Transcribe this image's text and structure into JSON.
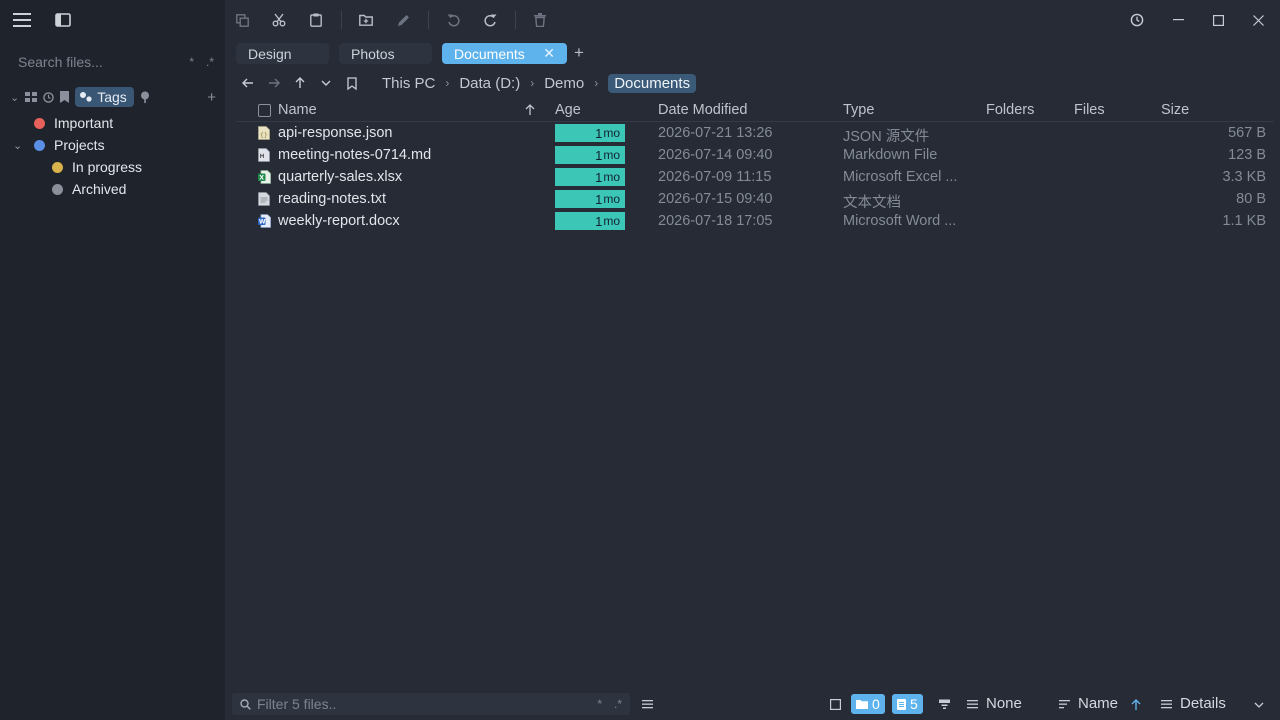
{
  "sidebar": {
    "search_placeholder": "Search files...",
    "search_mod_star": "*",
    "search_mod_regex": ".*",
    "tags_label": "Tags",
    "tree": [
      {
        "label": "Important",
        "color": "#e8605a"
      },
      {
        "label": "Projects",
        "color": "#5b8ee6"
      },
      {
        "label": "In progress",
        "color": "#d8b24a"
      },
      {
        "label": "Archived",
        "color": "#8b8f99"
      }
    ]
  },
  "tabs": [
    {
      "label": "Design"
    },
    {
      "label": "Photos"
    },
    {
      "label": "Documents"
    }
  ],
  "tab_close": "✕",
  "tab_new": "+",
  "breadcrumb": [
    "This PC",
    "Data (D:)",
    "Demo",
    "Documents"
  ],
  "breadcrumb_sep": "›",
  "columns": {
    "name": "Name",
    "age": "Age",
    "date_modified": "Date Modified",
    "type": "Type",
    "folders": "Folders",
    "files": "Files",
    "size": "Size"
  },
  "files": [
    {
      "name": "api-response.json",
      "age_num": "1",
      "age_unit": "mo",
      "date": "2026-07-21 13:26",
      "type": "JSON 源文件",
      "size": "567 B",
      "icon": "json-file-icon"
    },
    {
      "name": "meeting-notes-0714.md",
      "age_num": "1",
      "age_unit": "mo",
      "date": "2026-07-14 09:40",
      "type": "Markdown File",
      "size": "123 B",
      "icon": "markdown-file-icon"
    },
    {
      "name": "quarterly-sales.xlsx",
      "age_num": "1",
      "age_unit": "mo",
      "date": "2026-07-09 11:15",
      "type": "Microsoft Excel ...",
      "size": "3.3 KB",
      "icon": "excel-file-icon"
    },
    {
      "name": "reading-notes.txt",
      "age_num": "1",
      "age_unit": "mo",
      "date": "2026-07-15 09:40",
      "type": "文本文档",
      "size": "80 B",
      "icon": "text-file-icon"
    },
    {
      "name": "weekly-report.docx",
      "age_num": "1",
      "age_unit": "mo",
      "date": "2026-07-18 17:05",
      "type": "Microsoft Word ...",
      "size": "1.1 KB",
      "icon": "word-file-icon"
    }
  ],
  "bottom": {
    "filter_placeholder": "Filter 5 files..",
    "filter_mod_star": "*",
    "filter_mod_regex": ".*",
    "folder_count": "0",
    "file_count": "5",
    "group_label": "None",
    "sort_label": "Name",
    "view_label": "Details"
  },
  "colors": {
    "accent": "#5fb3ec",
    "age_badge": "#3cc6b5",
    "background": "#262b35",
    "sidebar": "#1f232b"
  }
}
